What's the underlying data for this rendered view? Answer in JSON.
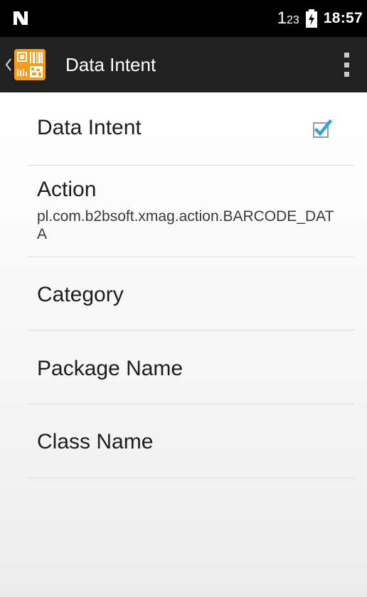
{
  "status_bar": {
    "nfc_icon": "nfc-icon",
    "keypad_indicator_main": "1",
    "keypad_indicator_sub": "23",
    "battery_icon": "battery-charging-icon",
    "time": "18:57"
  },
  "app_bar": {
    "up_icon": "back-chevron-icon",
    "app_icon": "barcode-app-icon",
    "title": "Data Intent",
    "overflow_icon": "overflow-menu-icon"
  },
  "preferences": [
    {
      "title": "Data Intent",
      "checked": true
    },
    {
      "title": "Action",
      "summary": "pl.com.b2bsoft.xmag.action.BARCODE_DATA"
    },
    {
      "title": "Category"
    },
    {
      "title": "Package Name"
    },
    {
      "title": "Class Name"
    }
  ],
  "colors": {
    "status_bar_bg": "#000000",
    "app_bar_bg": "#212121",
    "app_icon_orange": "#f39c1e",
    "checkbox_accent": "#33a3dc"
  }
}
